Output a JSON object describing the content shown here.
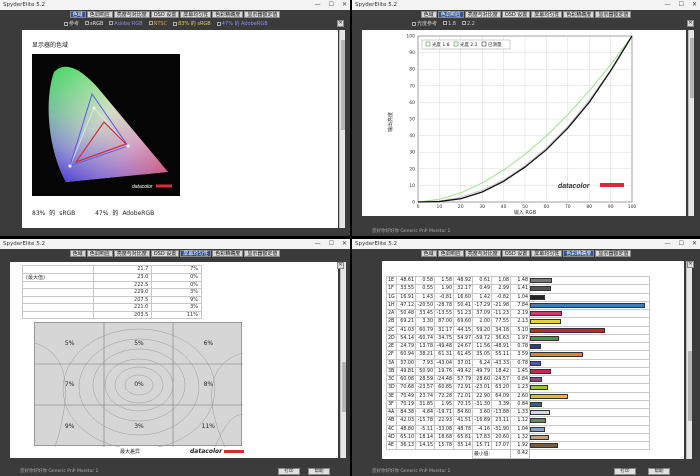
{
  "app_title": "SpyderElite 5.2",
  "window_controls": {
    "minimize": "—",
    "maximize": "☐",
    "close": "✕"
  },
  "tabs": [
    "色域",
    "色调响应",
    "亮度与对比度",
    "OSD 设置",
    "屏幕均匀性",
    "色彩精确度",
    "显示器额定值"
  ],
  "pane1": {
    "active_tab": 0,
    "legend": [
      {
        "label": "参考",
        "color": "#cccccc"
      },
      {
        "label": "sRGB",
        "color": "#e2e2e2"
      },
      {
        "label": "Adobe RGB",
        "color": "#8b8bd8"
      },
      {
        "label": "NTSC",
        "color": "#d8a04a"
      },
      {
        "label": "83% 的 sRGB",
        "color": "#dcd23a"
      },
      {
        "label": "47% 的 AdobeRGB",
        "color": "#8b8bff"
      }
    ],
    "heading": "显示器的色域",
    "result_srgb_pct": "83%",
    "result_srgb_of": "的",
    "result_srgb_name": "sRGB",
    "result_adobe_pct": "47%",
    "result_adobe_of": "的",
    "result_adobe_name": "AdobeRGB",
    "logo": "datacolor"
  },
  "pane2": {
    "active_tab": 1,
    "legend": [
      {
        "label": "光度参考",
        "color": "#cccccc"
      },
      {
        "label": "1.8",
        "color": "#cccccc"
      },
      {
        "label": "2.2",
        "color": "#cccccc"
      }
    ],
    "logo": "datacolor"
  },
  "pane3": {
    "active_tab": 4,
    "logo": "datacolor",
    "uniformity_rows": [
      [
        "",
        "21.7",
        "7%"
      ],
      [
        "(最大值)",
        "23.0",
        "0%"
      ],
      [
        "",
        "222.5",
        "0%"
      ],
      [
        "",
        "229.0",
        "3%"
      ],
      [
        "",
        "207.5",
        "9%"
      ],
      [
        "",
        "221.0",
        "3%"
      ],
      [
        "",
        "203.5",
        "11%"
      ]
    ],
    "uniformity_grid": [
      "5%",
      "5%",
      "6%",
      "7%",
      "0%",
      "8%",
      "9%",
      "3%",
      "11%"
    ],
    "caption": "最大差异"
  },
  "pane4": {
    "active_tab": 5,
    "rows": [
      [
        "1E",
        "48.61",
        "0.58",
        "1.58",
        "48.92",
        "0.61",
        "1.08",
        "1.48"
      ],
      [
        "1F",
        "33.55",
        "0.55",
        "1.90",
        "32.17",
        "0.49",
        "2.99",
        "1.41"
      ],
      [
        "1G",
        "16.91",
        "1.43",
        "-0.81",
        "16.60",
        "1.42",
        "-0.82",
        "1.04"
      ],
      [
        "1H",
        "47.12",
        "-20.50",
        "-28.78",
        "50.41",
        "-17.29",
        "-21.98",
        "7.84"
      ],
      [
        "2A",
        "50.48",
        "33.45",
        "-13.55",
        "51.23",
        "37.09",
        "-11.23",
        "2.19"
      ],
      [
        "2B",
        "69.21",
        "3.30",
        "87.00",
        "69.60",
        "2.00",
        "77.55",
        "2.13"
      ],
      [
        "2C",
        "41.03",
        "60.79",
        "31.17",
        "44.15",
        "59.20",
        "34.18",
        "5.10"
      ],
      [
        "2D",
        "54.14",
        "-60.74",
        "34.75",
        "54.97",
        "-59.72",
        "36.63",
        "1.97"
      ],
      [
        "2E",
        "24.79",
        "13.78",
        "-49.48",
        "24.67",
        "11.56",
        "-48.91",
        "0.78"
      ],
      [
        "2F",
        "60.94",
        "38.21",
        "61.31",
        "61.45",
        "35.05",
        "55.11",
        "3.59"
      ],
      [
        "3A",
        "37.00",
        "7.93",
        "-43.04",
        "37.01",
        "6.24",
        "-43.33",
        "0.78"
      ],
      [
        "3B",
        "49.81",
        "50.90",
        "19.76",
        "49.42",
        "49.79",
        "18.42",
        "1.45"
      ],
      [
        "3C",
        "60.08",
        "28.59",
        "-24.48",
        "57.79",
        "28.60",
        "-24.57",
        "0.84"
      ],
      [
        "3D",
        "70.68",
        "-23.57",
        "60.85",
        "72.91",
        "-23.01",
        "63.20",
        "1.23"
      ],
      [
        "3E",
        "70.49",
        "23.74",
        "72.28",
        "72.01",
        "22.90",
        "64.09",
        "2.60"
      ],
      [
        "3F",
        "70.19",
        "31.85",
        "1.95",
        "70.15",
        "-31.30",
        "3.39",
        "0.84"
      ],
      [
        "4A",
        "84.38",
        "4.84",
        "-19.71",
        "84.60",
        "3.60",
        "-13.88",
        "1.33"
      ],
      [
        "4B",
        "42.03",
        "-15.78",
        "22.93",
        "41.51",
        "-16.89",
        "23.11",
        "1.12"
      ],
      [
        "4C",
        "48.80",
        "-5.11",
        "-33.08",
        "48.78",
        "-4.16",
        "-31.90",
        "1.04"
      ],
      [
        "4D",
        "65.10",
        "18.14",
        "18.68",
        "65.81",
        "17.83",
        "20.60",
        "1.32"
      ],
      [
        "4E",
        "36.13",
        "14.15",
        "15.78",
        "35.14",
        "15.71",
        "17.07",
        "1.92"
      ]
    ],
    "bars": [
      {
        "value": 1.48,
        "color": "#7a7a7a"
      },
      {
        "value": 1.41,
        "color": "#555555"
      },
      {
        "value": 1.04,
        "color": "#222222"
      },
      {
        "value": 7.84,
        "color": "#3b7db9"
      },
      {
        "value": 2.19,
        "color": "#c83c6c"
      },
      {
        "value": 2.13,
        "color": "#e8d23a"
      },
      {
        "value": 5.1,
        "color": "#c8262a"
      },
      {
        "value": 1.97,
        "color": "#3aa050"
      },
      {
        "value": 0.78,
        "color": "#2a3a8a"
      },
      {
        "value": 3.59,
        "color": "#e0822a"
      },
      {
        "value": 0.78,
        "color": "#4a5aa8"
      },
      {
        "value": 1.45,
        "color": "#c8264a"
      },
      {
        "value": 0.84,
        "color": "#8a4a8a"
      },
      {
        "value": 1.23,
        "color": "#9ac83a"
      },
      {
        "value": 2.6,
        "color": "#e8b43a"
      },
      {
        "value": 0.84,
        "color": "#3a5a9a"
      },
      {
        "value": 1.33,
        "color": "#d8d8e8"
      },
      {
        "value": 1.12,
        "color": "#6a8a4a"
      },
      {
        "value": 1.04,
        "color": "#8aa0c8"
      },
      {
        "value": 1.32,
        "color": "#c8a080"
      },
      {
        "value": 1.92,
        "color": "#7a5a3a"
      }
    ],
    "summary": [
      {
        "label": "最小值:",
        "value": "0.42"
      },
      {
        "label": "最大值:",
        "value": "7.84"
      },
      {
        "label": "平均值:",
        "value": "1.76"
      }
    ]
  },
  "chart_data": [
    {
      "type": "line",
      "series": [
        {
          "name": "光度 1.8",
          "x": [
            0,
            10,
            20,
            30,
            40,
            50,
            60,
            70,
            80,
            90,
            100
          ],
          "values": [
            0,
            1.6,
            5.5,
            11.5,
            19.2,
            28.7,
            39.8,
            52.6,
            66.9,
            82.7,
            100
          ]
        },
        {
          "name": "光度 2.2",
          "x": [
            0,
            10,
            20,
            30,
            40,
            50,
            60,
            70,
            80,
            90,
            100
          ],
          "values": [
            0,
            0.6,
            2.9,
            7.1,
            13.3,
            21.8,
            32.5,
            45.6,
            61.2,
            79.3,
            100
          ]
        },
        {
          "name": "已测量",
          "x": [
            0,
            10,
            20,
            30,
            40,
            50,
            60,
            70,
            80,
            90,
            100
          ],
          "values": [
            0,
            0.3,
            2,
            6,
            12.5,
            21,
            31.5,
            44.5,
            60,
            79,
            100
          ]
        }
      ],
      "xlabel": "输入 RGB",
      "ylabel": "输出亮度",
      "xlim": [
        0,
        100
      ],
      "ylim": [
        0,
        100
      ],
      "x_ticks": [
        "0",
        "10",
        "20",
        "30",
        "40",
        "50",
        "60",
        "70",
        "80",
        "90",
        "100"
      ],
      "y_ticks": [
        "0",
        "10",
        "20",
        "30",
        "40",
        "50",
        "60",
        "70",
        "80",
        "90",
        "100"
      ],
      "grid": true,
      "legend": "top-left"
    }
  ],
  "footer": {
    "text": "您好你好好你 Generic PnP Monitor 1",
    "btn_a": "打印",
    "btn_b": "帮助"
  }
}
